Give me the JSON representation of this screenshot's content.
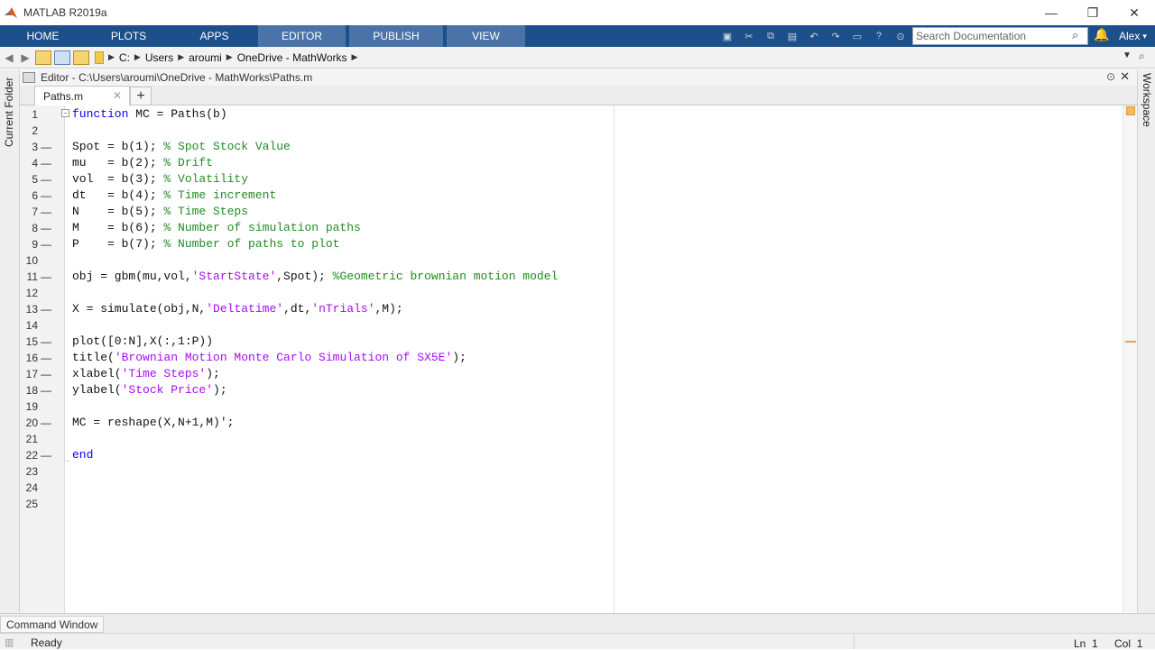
{
  "app": {
    "title": "MATLAB R2019a"
  },
  "ribbon": {
    "tabs": [
      {
        "label": "HOME"
      },
      {
        "label": "PLOTS"
      },
      {
        "label": "APPS"
      },
      {
        "label": "EDITOR"
      },
      {
        "label": "PUBLISH"
      },
      {
        "label": "VIEW"
      }
    ],
    "search_placeholder": "Search Documentation",
    "user": "Alex"
  },
  "address": {
    "crumbs": [
      "C:",
      "Users",
      "aroumi",
      "OneDrive - MathWorks"
    ]
  },
  "panels": {
    "left": "Current Folder",
    "right": "Workspace"
  },
  "editor": {
    "path_label": "Editor - C:\\Users\\aroumi\\OneDrive - MathWorks\\Paths.m",
    "file_tab": "Paths.m",
    "add_tab": "+",
    "lines": [
      {
        "n": "1",
        "dash": "",
        "code": "function MC = Paths(b)"
      },
      {
        "n": "2",
        "dash": "",
        "code": ""
      },
      {
        "n": "3",
        "dash": "—",
        "code": "Spot = b(1); % Spot Stock Value"
      },
      {
        "n": "4",
        "dash": "—",
        "code": "mu   = b(2); % Drift"
      },
      {
        "n": "5",
        "dash": "—",
        "code": "vol  = b(3); % Volatility"
      },
      {
        "n": "6",
        "dash": "—",
        "code": "dt   = b(4); % Time increment"
      },
      {
        "n": "7",
        "dash": "—",
        "code": "N    = b(5); % Time Steps"
      },
      {
        "n": "8",
        "dash": "—",
        "code": "M    = b(6); % Number of simulation paths"
      },
      {
        "n": "9",
        "dash": "—",
        "code": "P    = b(7); % Number of paths to plot"
      },
      {
        "n": "10",
        "dash": "",
        "code": ""
      },
      {
        "n": "11",
        "dash": "—",
        "code": "obj = gbm(mu,vol,'StartState',Spot); %Geometric brownian motion model"
      },
      {
        "n": "12",
        "dash": "",
        "code": ""
      },
      {
        "n": "13",
        "dash": "—",
        "code": "X = simulate(obj,N,'Deltatime',dt,'nTrials',M);"
      },
      {
        "n": "14",
        "dash": "",
        "code": ""
      },
      {
        "n": "15",
        "dash": "—",
        "code": "plot([0:N],X(:,1:P))"
      },
      {
        "n": "16",
        "dash": "—",
        "code": "title('Brownian Motion Monte Carlo Simulation of SX5E');"
      },
      {
        "n": "17",
        "dash": "—",
        "code": "xlabel('Time Steps');"
      },
      {
        "n": "18",
        "dash": "—",
        "code": "ylabel('Stock Price');"
      },
      {
        "n": "19",
        "dash": "",
        "code": ""
      },
      {
        "n": "20",
        "dash": "—",
        "code": "MC = reshape(X,N+1,M)';"
      },
      {
        "n": "21",
        "dash": "",
        "code": ""
      },
      {
        "n": "22",
        "dash": "—",
        "code": "end"
      },
      {
        "n": "23",
        "dash": "",
        "code": ""
      },
      {
        "n": "24",
        "dash": "",
        "code": ""
      },
      {
        "n": "25",
        "dash": "",
        "code": ""
      }
    ]
  },
  "bottom": {
    "command_window": "Command Window",
    "status": "Ready",
    "ln_label": "Ln",
    "ln_value": "1",
    "col_label": "Col",
    "col_value": "1"
  }
}
